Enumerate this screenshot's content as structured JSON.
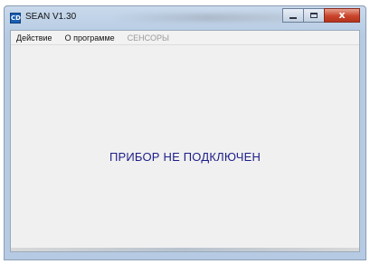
{
  "window": {
    "title": "SEAN V1.30",
    "icon": "app-icon",
    "icon_text": "CD",
    "controls": {
      "minimize": "minimize-icon",
      "maximize": "maximize-icon",
      "close": "close-icon",
      "close_glyph": "x"
    }
  },
  "menu": {
    "items": [
      {
        "label": "Действие",
        "enabled": true
      },
      {
        "label": "О программе",
        "enabled": true
      },
      {
        "label": "СЕНСОРЫ",
        "enabled": false
      }
    ]
  },
  "main": {
    "status_message": "ПРИБОР НЕ ПОДКЛЮЧЕН"
  },
  "colors": {
    "status_text": "#1e1e8a",
    "window_frame": "#b6cbe3",
    "close_button": "#c9442b"
  }
}
